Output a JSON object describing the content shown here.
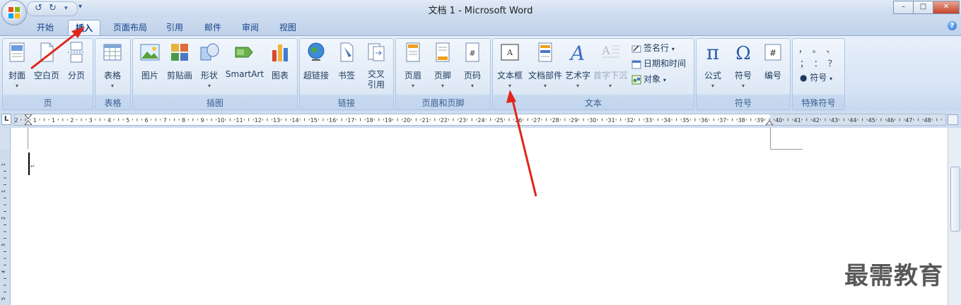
{
  "window": {
    "title": "文档 1 - Microsoft Word",
    "controls": {
      "minimize": "–",
      "maximize": "□",
      "close": "✕"
    }
  },
  "quick_access": {
    "undo": "↺",
    "redo": "↻",
    "more": "▾"
  },
  "tabs": [
    {
      "label": "开始",
      "active": false
    },
    {
      "label": "插入",
      "active": true
    },
    {
      "label": "页面布局",
      "active": false
    },
    {
      "label": "引用",
      "active": false
    },
    {
      "label": "邮件",
      "active": false
    },
    {
      "label": "审阅",
      "active": false
    },
    {
      "label": "视图",
      "active": false
    }
  ],
  "help": "?",
  "ribbon": {
    "groups": {
      "pages": {
        "label": "页",
        "buttons": [
          "封面",
          "空白页",
          "分页"
        ]
      },
      "tables": {
        "label": "表格",
        "buttons": [
          "表格"
        ]
      },
      "illustrations": {
        "label": "插图",
        "buttons": [
          "图片",
          "剪贴画",
          "形状",
          "SmartArt",
          "图表"
        ]
      },
      "links": {
        "label": "链接",
        "buttons": [
          "超链接",
          "书签",
          "交叉\n引用"
        ],
        "xref_line1": "交叉",
        "xref_line2": "引用"
      },
      "header_footer": {
        "label": "页眉和页脚",
        "buttons": [
          "页眉",
          "页脚",
          "页码"
        ]
      },
      "text": {
        "label": "文本",
        "buttons": [
          "文本框",
          "文档部件",
          "艺术字",
          "首字下沉"
        ],
        "small": [
          "签名行",
          "日期和时间",
          "对象"
        ]
      },
      "symbols": {
        "label": "符号",
        "buttons": [
          "公式",
          "符号",
          "编号"
        ]
      },
      "special": {
        "label": "特殊符号",
        "row1": "，  。  、",
        "row2": "；  ：  ？",
        "symbol_btn": "符号"
      }
    }
  },
  "ruler": {
    "numbers": [
      "2",
      "1",
      "1",
      "2",
      "3",
      "4",
      "5",
      "6",
      "7",
      "8",
      "9",
      "10",
      "11",
      "12",
      "13",
      "14",
      "15",
      "16",
      "17",
      "18",
      "19",
      "20",
      "21",
      "22",
      "23",
      "24",
      "25",
      "26",
      "27",
      "28",
      "29",
      "30",
      "31",
      "32",
      "33",
      "34",
      "35",
      "36",
      "37",
      "38",
      "39",
      "40",
      "41",
      "42",
      "43",
      "44",
      "45",
      "46",
      "47",
      "48"
    ],
    "vnumbers": [
      "1",
      "1",
      "2",
      "3",
      "4",
      "5"
    ],
    "corner": "L"
  },
  "watermark": "最需教育"
}
